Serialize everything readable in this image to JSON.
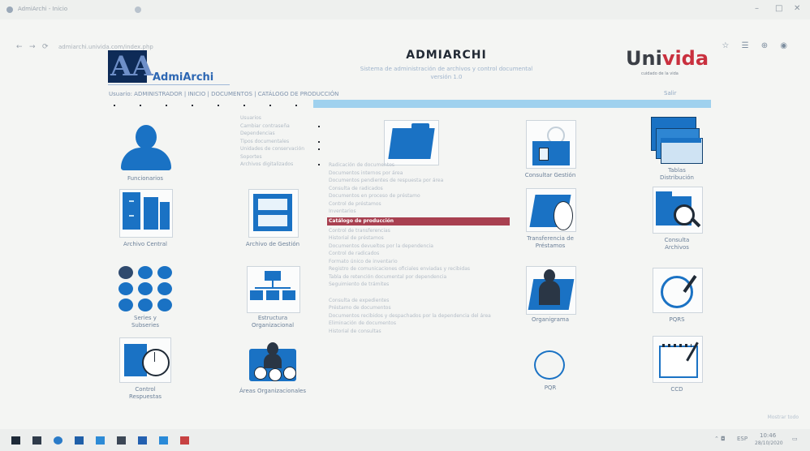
{
  "header": {
    "app_title": "ADMIARCHI",
    "subtitle_line1": "Sistema de administración de archivos y control documental",
    "subtitle_line2": "versión 1.0",
    "logo_letters": "AA",
    "logo_text": "AdmiArchi",
    "partner_logo_left": "Uni",
    "partner_logo_right": "vida",
    "partner_tagline": "cuidado de la vida",
    "breadcrumb": "Usuario: ADMINISTRADOR | INICIO | DOCUMENTOS | CATÁLOGO DE PRODUCCIÓN",
    "salir_label": "Salir"
  },
  "colors": {
    "accent_blue": "#1a72c4",
    "selected_row": "#a84050",
    "brand_red": "#c9303e",
    "strip": "#9fd1ee"
  },
  "tiles": {
    "funcionarios": {
      "label": "Funcionarios",
      "icon": "user-icon"
    },
    "archivo_central": {
      "label": "Archivo Central",
      "icon": "file-cabinet-icon"
    },
    "series": {
      "label": "Series y Subseries",
      "icon": "grid-dots-icon"
    },
    "control": {
      "label": "Control Respuestas",
      "icon": "clock-icon"
    },
    "archivo_gestion": {
      "label": "Archivo de Gestión",
      "icon": "drawer-cabinet-icon"
    },
    "estructura": {
      "label": "Estructura Organizacional",
      "icon": "org-chart-icon"
    },
    "areas": {
      "label": "Áreas Organizacionales",
      "icon": "people-group-icon"
    },
    "documentos": {
      "label": "",
      "icon": "folder-icon"
    },
    "consultar": {
      "label": "Consultar Gestión",
      "icon": "folder-lock-icon"
    },
    "transferencia": {
      "label": "Transferencia de Préstamos",
      "icon": "folder-transfer-icon"
    },
    "organigrama": {
      "label": "Organigrama",
      "icon": "folder-person-icon"
    },
    "pqr": {
      "label": "PQR",
      "icon": "circle-icon"
    },
    "tablas": {
      "label": "Tablas Distribución",
      "icon": "windows-stack-icon"
    },
    "consulta_archivo": {
      "label": "Consulta Archivos",
      "icon": "folder-search-icon"
    },
    "pqrs": {
      "label": "PQRS",
      "icon": "edit-box-icon"
    },
    "ccd": {
      "label": "CCD",
      "icon": "notepad-icon"
    }
  },
  "submenu_left": [
    "Usuarios",
    "Cambiar contraseña",
    "Dependencias",
    "Tipos documentales",
    "Unidades de conservación",
    "Soportes",
    "Archivos digitalizados"
  ],
  "submenu_docs": [
    "Radicación de documentos",
    "Documentos internos por área",
    "Documentos pendientes de respuesta por área",
    "Consulta de radicados",
    "Documentos en proceso de préstamo",
    "Control de préstamos",
    "Inventarios",
    "Catálogo de producción",
    "Control de transferencias",
    "Historial de préstamos",
    "Documentos devueltos por la dependencia",
    "Control de radicados",
    "Formato único de inventario",
    "Registro de comunicaciones oficiales enviadas y recibidas",
    "Tabla de retención documental por dependencia",
    "Seguimiento de trámites",
    "",
    "Consulta de expedientes",
    "Préstamo de documentos",
    "Documentos recibidos y despachados por la dependencia del área",
    "Eliminación de documentos",
    "Historial de consultas"
  ],
  "submenu_selected": "Catálogo de producción",
  "browser": {
    "tab_title": "AdmiArchi - Inicio",
    "url": "admiarchi.univida.com/index.php"
  },
  "footer": {
    "left": "",
    "right": "Mostrar todo"
  },
  "taskbar": {
    "clock_time": "10:46",
    "clock_date": "28/10/2020",
    "lang": "ESP"
  }
}
